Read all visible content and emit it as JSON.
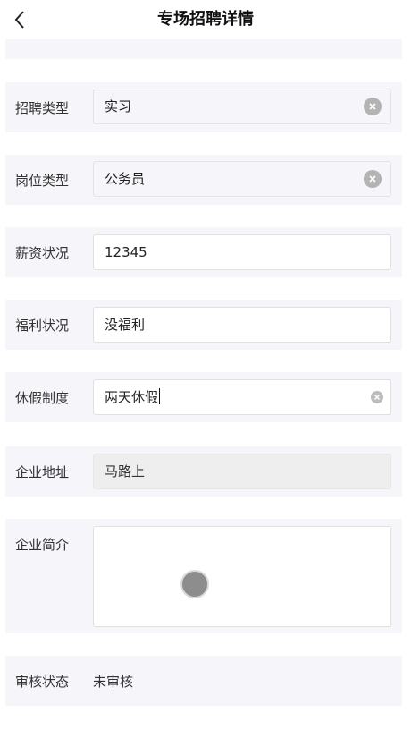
{
  "header": {
    "title": "专场招聘详情"
  },
  "form": {
    "recruit_type": {
      "label": "招聘类型",
      "value": "实习"
    },
    "position_type": {
      "label": "岗位类型",
      "value": "公务员"
    },
    "salary": {
      "label": "薪资状况",
      "value": "12345"
    },
    "welfare": {
      "label": "福利状况",
      "value": "没福利"
    },
    "vacation": {
      "label": "休假制度",
      "value": "两天休假"
    },
    "address": {
      "label": "企业地址",
      "value": "马路上"
    },
    "intro": {
      "label": "企业简介",
      "value": ""
    },
    "review": {
      "label": "审核状态",
      "value": "未审核"
    }
  },
  "icons": {
    "back": "chevron-left-icon",
    "clear": "clear-circle-icon"
  }
}
